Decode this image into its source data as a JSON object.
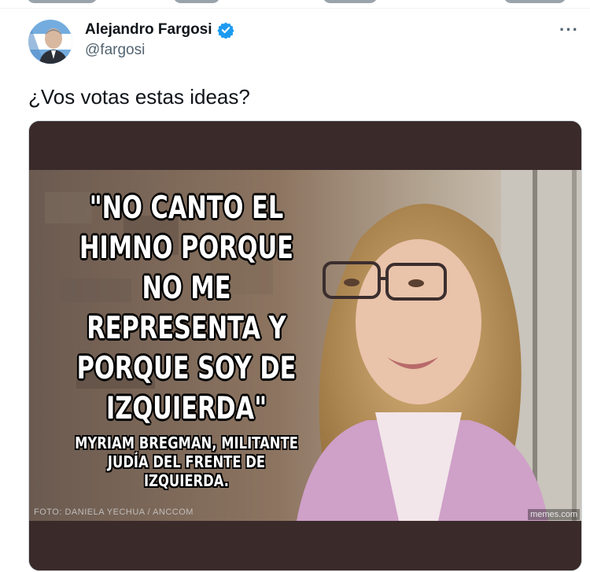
{
  "author": {
    "name": "Alejandro Fargosi",
    "handle": "@fargosi",
    "verified": true
  },
  "menu": {
    "more_label": "···"
  },
  "tweet": {
    "text": "¿Vos votas estas ideas?"
  },
  "media": {
    "quote_lines": [
      "\"NO CANTO EL",
      "HIMNO PORQUE",
      "NO ME",
      "REPRESENTA Y",
      "PORQUE SOY DE",
      "IZQUIERDA\""
    ],
    "caption_lines": [
      "MYRIAM BREGMAN, MILITANTE",
      "JUDÍA DEL FRENTE DE IZQUIERDA."
    ],
    "credit": "FOTO: DANIELA YECHUA / ANCCOM",
    "watermark": "memes.com"
  },
  "colors": {
    "verified_blue": "#1d9bf0",
    "text_primary": "#0f1419",
    "text_secondary": "#536471",
    "media_band": "#3a2a2a"
  },
  "icons": [
    "verified-badge-icon",
    "more-options-icon"
  ]
}
